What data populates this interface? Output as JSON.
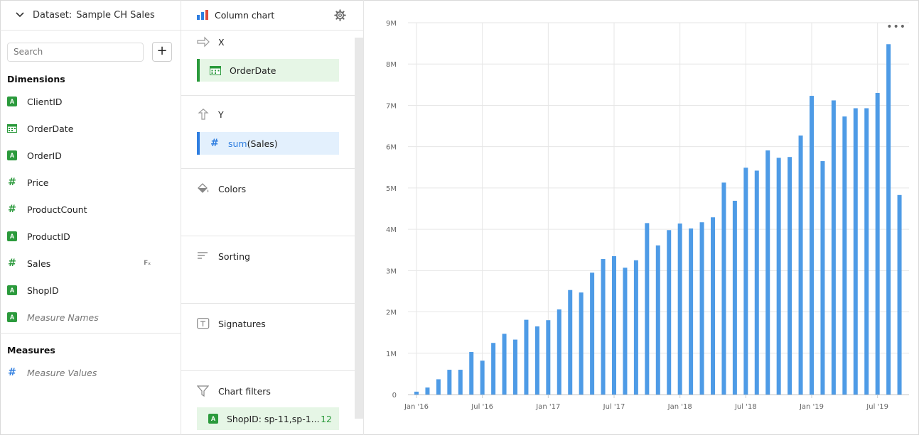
{
  "dataset": {
    "label": "Dataset:",
    "name": "Sample CH Sales"
  },
  "search": {
    "placeholder": "Search"
  },
  "add_button": "+",
  "dimensions": {
    "title": "Dimensions",
    "items": [
      {
        "label": "ClientID",
        "type": "string"
      },
      {
        "label": "OrderDate",
        "type": "date"
      },
      {
        "label": "OrderID",
        "type": "string"
      },
      {
        "label": "Price",
        "type": "number"
      },
      {
        "label": "ProductCount",
        "type": "number"
      },
      {
        "label": "ProductID",
        "type": "string"
      },
      {
        "label": "Sales",
        "type": "number",
        "badge": "Fₓ"
      },
      {
        "label": "ShopID",
        "type": "string"
      },
      {
        "label": "Measure Names",
        "type": "string"
      }
    ]
  },
  "measures": {
    "title": "Measures",
    "items": [
      {
        "label": "Measure Values",
        "type": "number"
      }
    ]
  },
  "visualization": {
    "label": "Column chart"
  },
  "sections": {
    "x": {
      "title": "X",
      "chip": "OrderDate"
    },
    "y": {
      "title": "Y",
      "chip_fn": "sum",
      "chip_arg": "(Sales)"
    },
    "colors": {
      "title": "Colors"
    },
    "sorting": {
      "title": "Sorting"
    },
    "signatures": {
      "title": "Signatures"
    },
    "filters": {
      "title": "Chart filters",
      "chip": "ShopID: sp-11,sp-1...",
      "count": "12"
    }
  },
  "menu_icon": "more-dots-icon",
  "colors": {
    "bar": "#4e9be6",
    "green": "#2b9a3c",
    "blue": "#2f7ee0"
  },
  "chart_data": {
    "type": "bar",
    "ylabels": [
      "0",
      "1M",
      "2M",
      "3M",
      "4M",
      "5M",
      "6M",
      "7M",
      "8M",
      "9M"
    ],
    "ylim": [
      0,
      9000000
    ],
    "xlabels": [
      "Jan '16",
      "Jul '16",
      "Jan '17",
      "Jul '17",
      "Jan '18",
      "Jul '18",
      "Jan '19",
      "Jul '19"
    ],
    "categories": [
      "2016-01",
      "2016-02",
      "2016-03",
      "2016-04",
      "2016-05",
      "2016-06",
      "2016-07",
      "2016-08",
      "2016-09",
      "2016-10",
      "2016-11",
      "2016-12",
      "2017-01",
      "2017-02",
      "2017-03",
      "2017-04",
      "2017-05",
      "2017-06",
      "2017-07",
      "2017-08",
      "2017-09",
      "2017-10",
      "2017-11",
      "2017-12",
      "2018-01",
      "2018-02",
      "2018-03",
      "2018-04",
      "2018-05",
      "2018-06",
      "2018-07",
      "2018-08",
      "2018-09",
      "2018-10",
      "2018-11",
      "2018-12",
      "2019-01",
      "2019-02",
      "2019-03",
      "2019-04",
      "2019-05",
      "2019-06",
      "2019-07",
      "2019-08",
      "2019-09"
    ],
    "values": [
      70000,
      170000,
      370000,
      600000,
      600000,
      1030000,
      820000,
      1250000,
      1470000,
      1330000,
      1810000,
      1650000,
      1800000,
      2060000,
      2530000,
      2470000,
      2950000,
      3280000,
      3350000,
      3070000,
      3250000,
      4150000,
      3610000,
      3980000,
      4140000,
      4020000,
      4170000,
      4290000,
      5130000,
      4690000,
      5490000,
      5420000,
      5910000,
      5730000,
      5750000,
      6270000,
      7230000,
      5650000,
      7120000,
      6730000,
      6930000,
      6930000,
      7300000,
      8480000,
      4830000
    ],
    "grid": true
  }
}
